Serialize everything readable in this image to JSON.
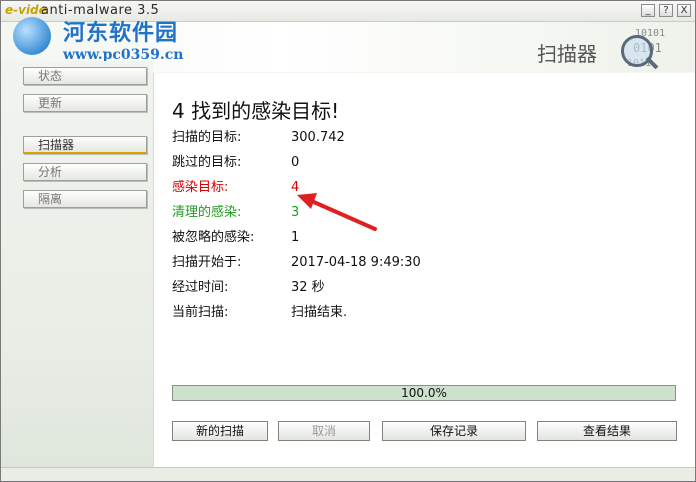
{
  "titlebar": {
    "logo": "e-vide",
    "title": "anti-malware 3.5",
    "min": "_",
    "help": "?",
    "close": "X"
  },
  "watermark": {
    "title": "河东软件园",
    "url": "www.pc0359.cn"
  },
  "header": {
    "title": "扫描器",
    "emblem_lines": [
      "10101",
      "0101",
      "1011"
    ]
  },
  "sidebar": {
    "items": [
      {
        "label": "状态"
      },
      {
        "label": "更新"
      },
      {
        "label": "扫描器"
      },
      {
        "label": "分析"
      },
      {
        "label": "隔离"
      }
    ]
  },
  "main": {
    "heading": "4 找到的感染目标!",
    "rows": [
      {
        "label": "扫描的目标:",
        "value": "300.742"
      },
      {
        "label": "跳过的目标:",
        "value": "0"
      },
      {
        "label": "感染目标:",
        "value": "4"
      },
      {
        "label": "清理的感染:",
        "value": "3"
      },
      {
        "label": "被忽略的感染:",
        "value": "1"
      },
      {
        "label": "扫描开始于:",
        "value": "2017-04-18 9:49:30"
      },
      {
        "label": "经过时间:",
        "value": "32 秒"
      },
      {
        "label": "当前扫描:",
        "value": "扫描结束."
      }
    ],
    "progress": {
      "value": 1.0,
      "text": "100.0%"
    },
    "buttons": {
      "new_scan": "新的扫描",
      "cancel": "取消",
      "save_log": "保存记录",
      "view_results": "查看结果"
    }
  },
  "colors": {
    "infected": "#d60000",
    "cleaned": "#1f9e1f",
    "active_accent": "#d9a300",
    "annotation_arrow": "#e02020"
  }
}
